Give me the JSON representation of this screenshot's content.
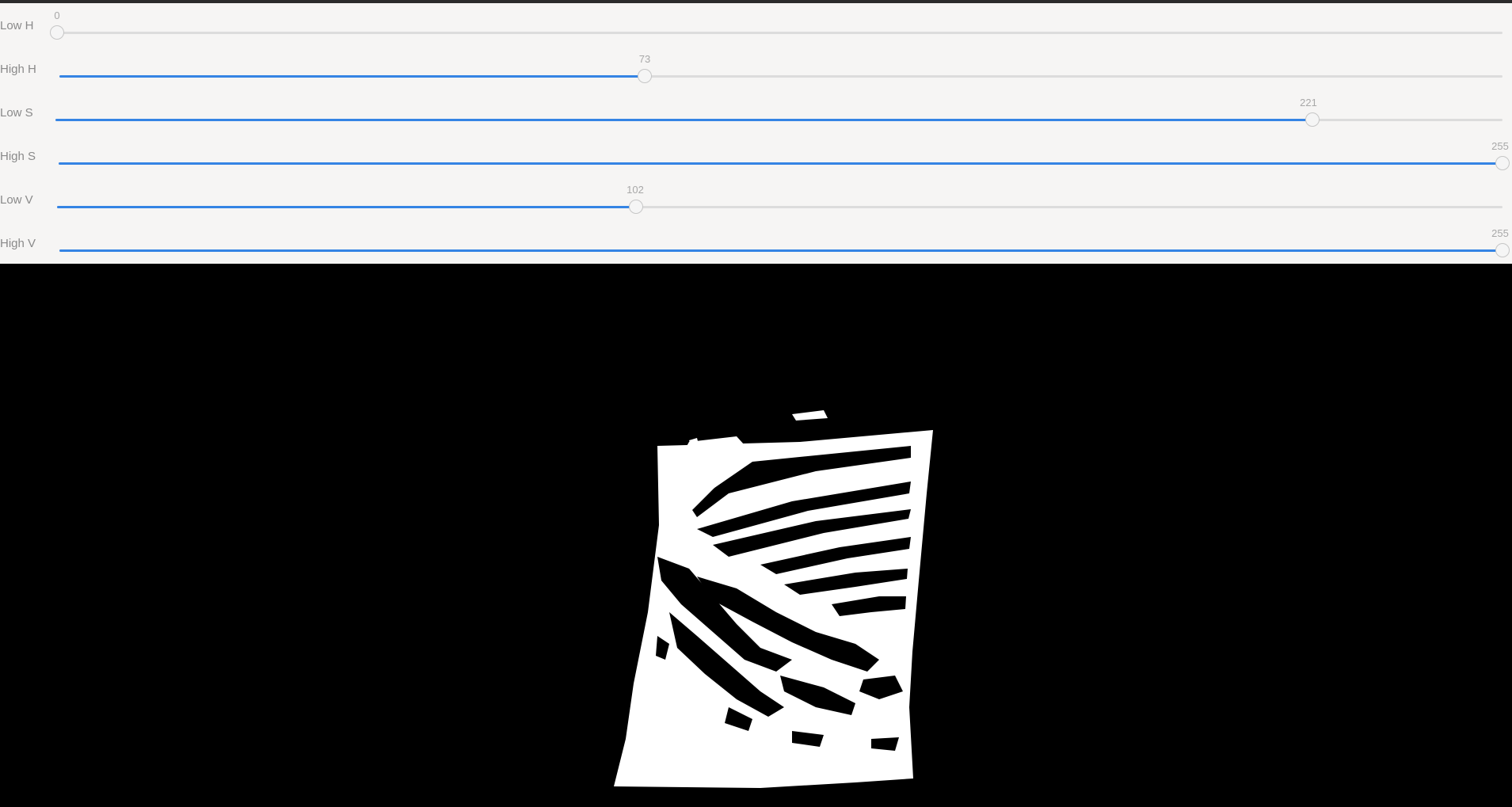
{
  "sliders": [
    {
      "label": "Low H",
      "value": "0",
      "min": 0,
      "max": 255,
      "fraction": 0.0
    },
    {
      "label": "High H",
      "value": "73",
      "min": 0,
      "max": 255,
      "fraction": 0.4055
    },
    {
      "label": "Low S",
      "value": "221",
      "min": 0,
      "max": 255,
      "fraction": 0.8684
    },
    {
      "label": "High S",
      "value": "255",
      "min": 0,
      "max": 255,
      "fraction": 1.0
    },
    {
      "label": "Low V",
      "value": "102",
      "min": 0,
      "max": 255,
      "fraction": 0.4003
    },
    {
      "label": "High V",
      "value": "255",
      "min": 0,
      "max": 255,
      "fraction": 1.0
    }
  ],
  "colors": {
    "accent": "#3584e4",
    "track": "#dcdcdc",
    "panel_bg": "#f6f5f4",
    "mask_bg": "#000000",
    "mask_fg": "#ffffff"
  },
  "mask_view": {
    "description_icon": "binary-mask-image"
  }
}
